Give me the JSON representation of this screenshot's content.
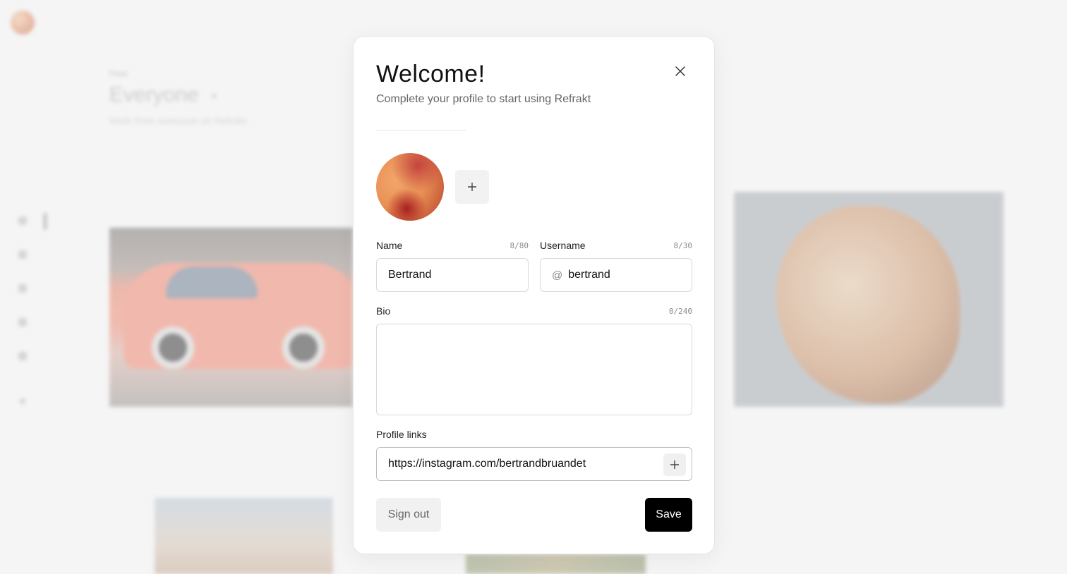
{
  "background": {
    "kicker": "Feed",
    "title": "Everyone",
    "subtitle": "Work from everyone on Refrakt",
    "caret_icon": "chevron-down-icon"
  },
  "modal": {
    "title": "Welcome!",
    "subtitle": "Complete your profile to start using Refrakt",
    "close_icon": "close-icon",
    "avatar_add_icon": "plus-icon",
    "fields": {
      "name": {
        "label": "Name",
        "counter": "8/80",
        "value": "Bertrand"
      },
      "username": {
        "label": "Username",
        "counter": "8/30",
        "prefix": "@",
        "value": "bertrand"
      },
      "bio": {
        "label": "Bio",
        "counter": "0/240",
        "value": ""
      },
      "profile_links": {
        "label": "Profile links",
        "value": "https://instagram.com/bertrandbruandet",
        "add_icon": "plus-icon"
      }
    },
    "buttons": {
      "sign_out": "Sign out",
      "save": "Save"
    }
  },
  "colors": {
    "save_button_bg": "#000000",
    "secondary_button_bg": "#f1f1f1",
    "page_bg": "#f5f5f5"
  }
}
